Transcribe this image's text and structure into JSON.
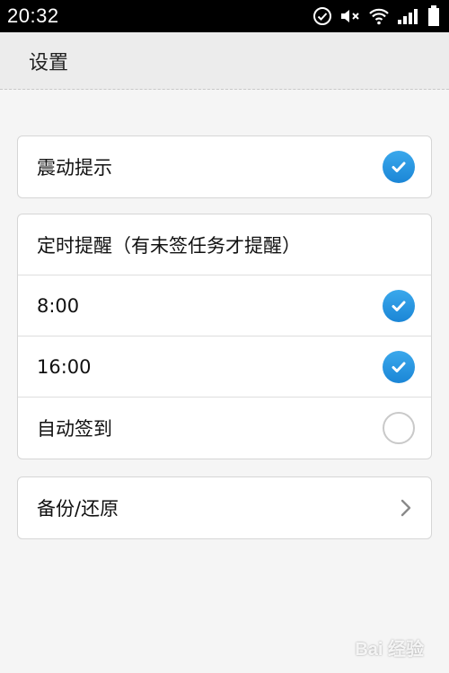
{
  "status_bar": {
    "time": "20:32",
    "icons": [
      "check-circle-icon",
      "mute-icon",
      "wifi-icon",
      "signal-icon",
      "battery-icon"
    ]
  },
  "header": {
    "title": "设置"
  },
  "vibration_card": {
    "label": "震动提示",
    "checked": true
  },
  "reminder_card": {
    "header": "定时提醒（有未签任务才提醒）",
    "items": [
      {
        "label": "8:00",
        "checked": true
      },
      {
        "label": "16:00",
        "checked": true
      },
      {
        "label": "自动签到",
        "checked": false
      }
    ]
  },
  "backup_card": {
    "label": "备份/还原"
  },
  "colors": {
    "accent": "#1b86d6",
    "status_bar": "#000000",
    "background": "#f5f5f5"
  },
  "watermark": "Bai 经验"
}
